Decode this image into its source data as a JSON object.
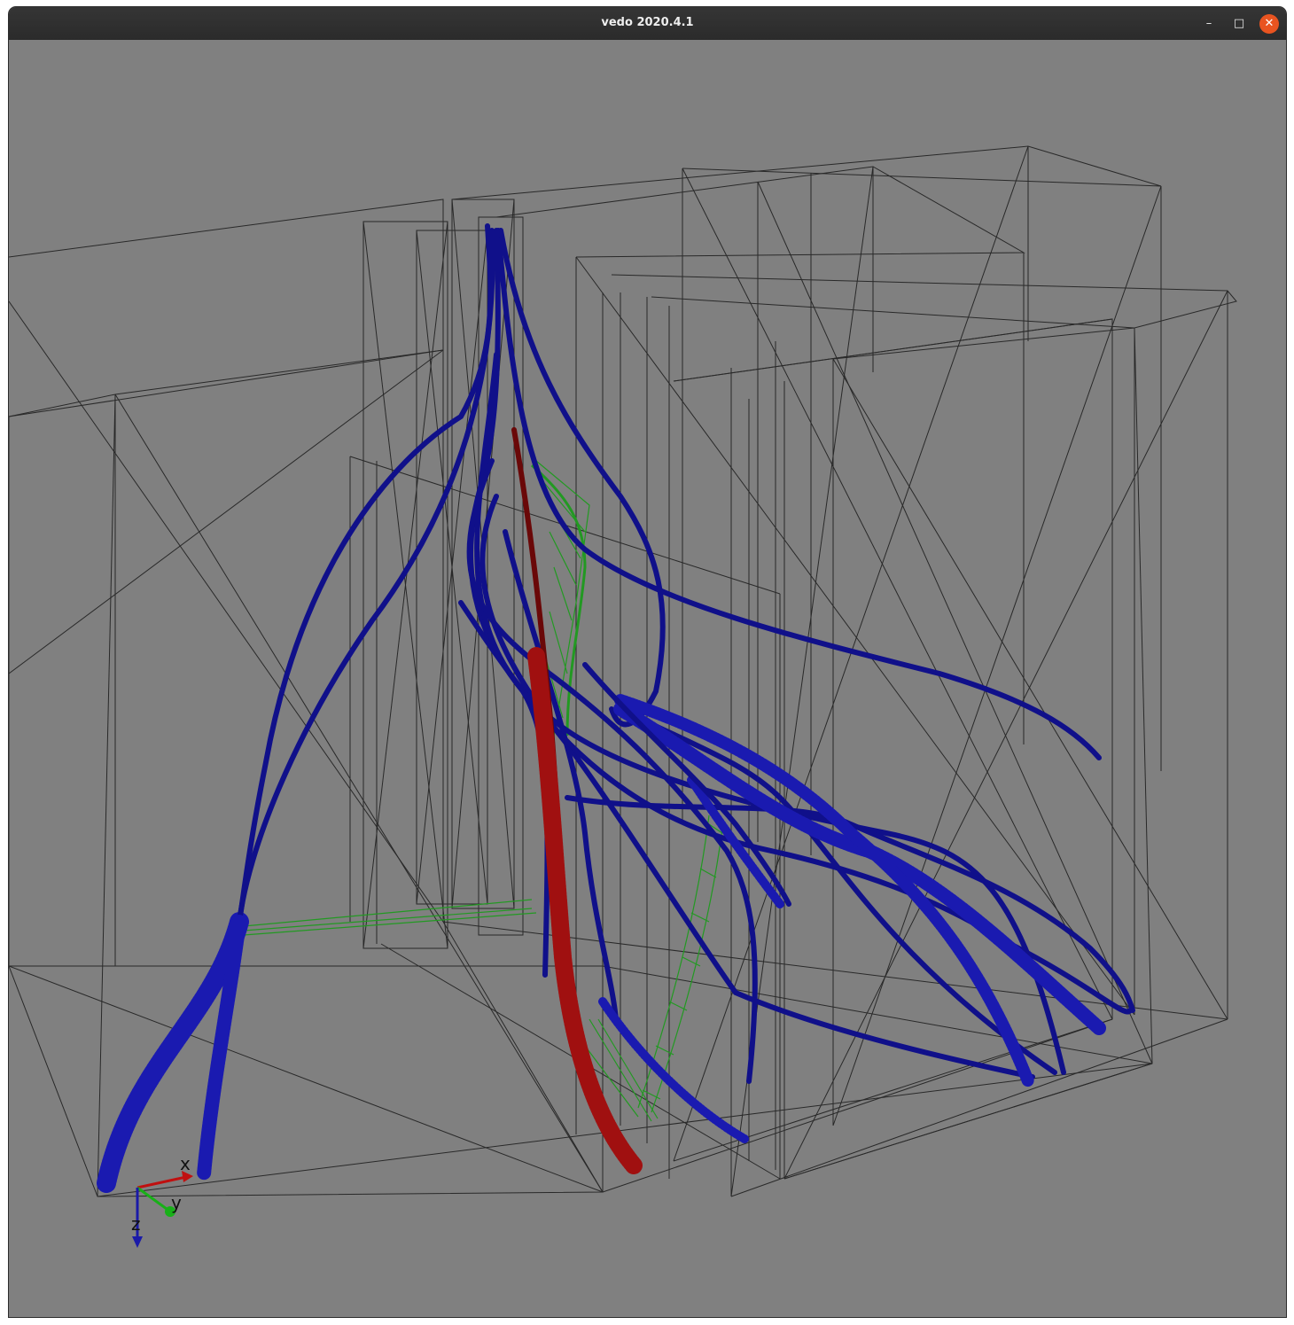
{
  "window": {
    "title": "vedo 2020.4.1",
    "buttons": {
      "minimize": "–",
      "maximize": "□",
      "close": "✕"
    }
  },
  "scene": {
    "background_color": "#808080",
    "box_wire_color": "#1a1a1a",
    "tube_colors": {
      "blue": "#1010a0",
      "red": "#8a0a0a",
      "green": "#229922"
    },
    "axes_labels": {
      "x": "x",
      "y": "y",
      "z": "z"
    },
    "axes_colors": {
      "x": "#c01010",
      "y": "#18b018",
      "z": "#1a1aa8"
    }
  }
}
